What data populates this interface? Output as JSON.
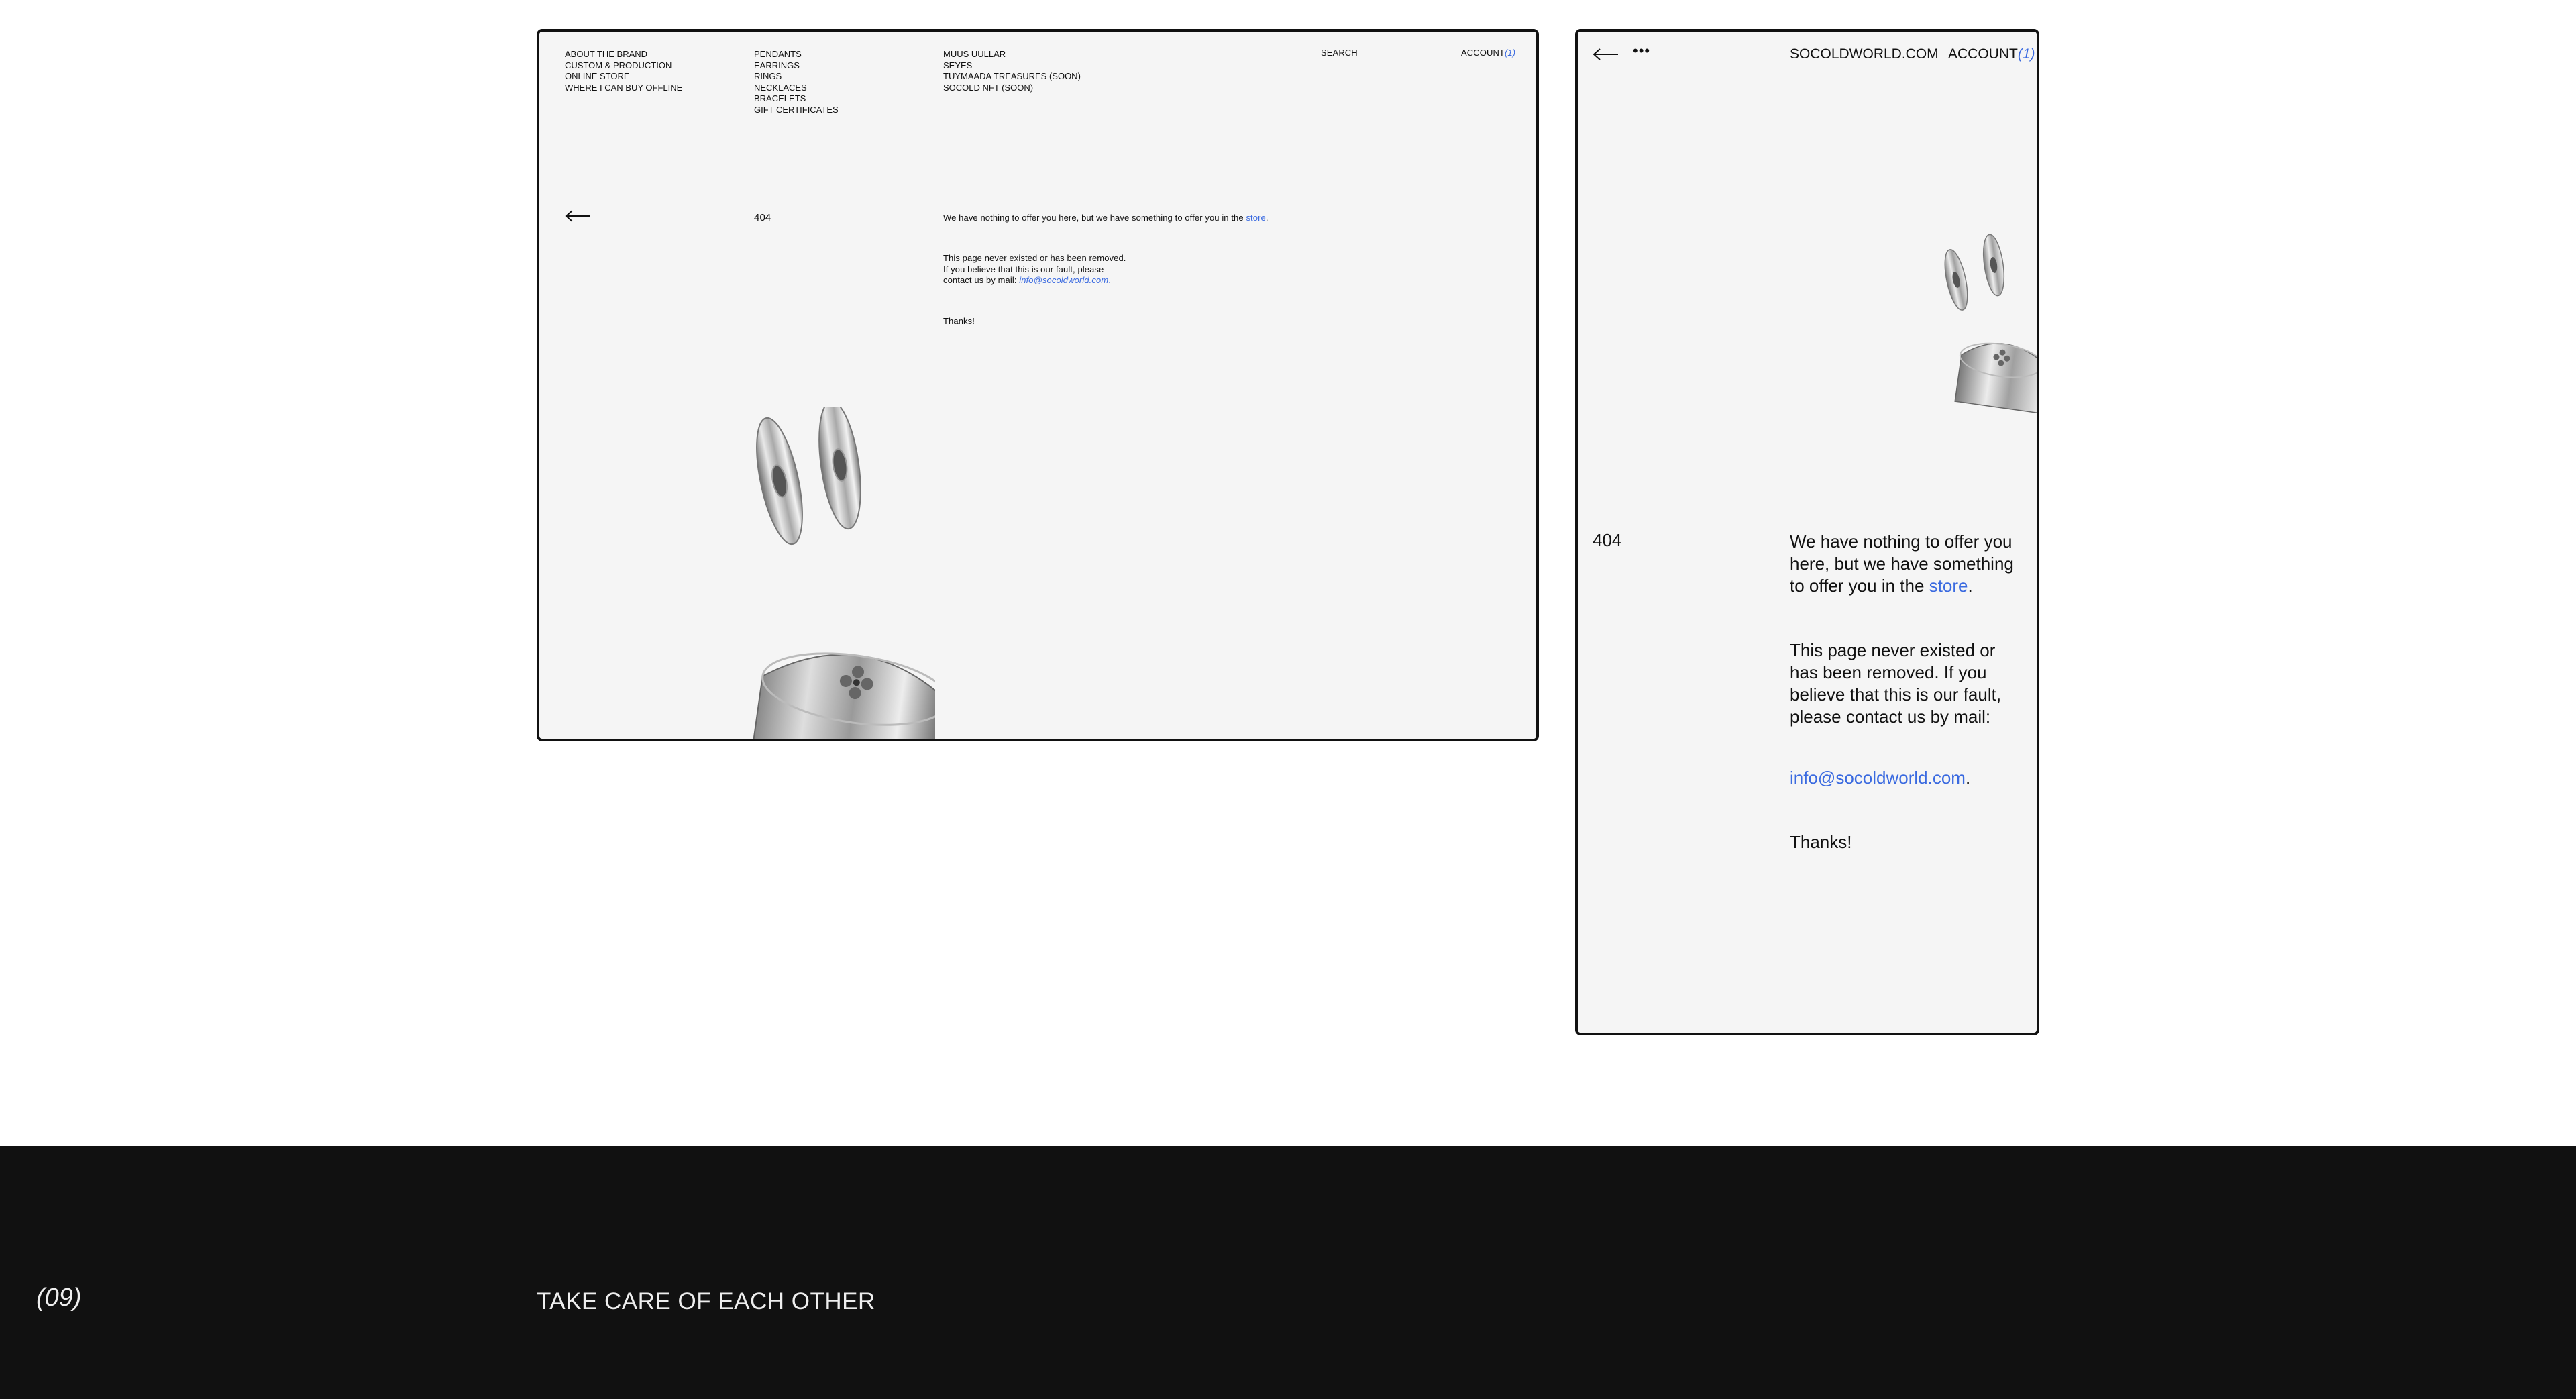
{
  "desktop": {
    "nav_col1": [
      "ABOUT THE BRAND",
      "CUSTOM & PRODUCTION",
      "ONLINE STORE",
      "WHERE I CAN BUY OFFLINE"
    ],
    "nav_col2": [
      "PENDANTS",
      "EARRINGS",
      "RINGS",
      "NECKLACES",
      "BRACELETS",
      "GIFT CERTIFICATES"
    ],
    "nav_col3": [
      "MUUS UULLAR",
      "SEYES",
      "TUYMAADA TREASURES (SOON)",
      "SOCOLD NFT (SOON)"
    ],
    "search_label": "SEARCH",
    "account_label": "ACCOUNT",
    "account_count": "(1)",
    "error_code": "404",
    "message_prefix": "We have nothing to offer you here, but we have something to offer you in the ",
    "store_link": "store",
    "message_suffix": ".",
    "removed_line1": "This page never existed or has been removed.",
    "removed_line2": "If you believe that this is our fault, please",
    "removed_line3_prefix": "contact us by mail: ",
    "email": "info@socoldworld.com",
    "email_suffix": ".",
    "thanks": "Thanks!"
  },
  "mobile": {
    "menu_dots": "•••",
    "site_title": "SOCOLDWORLD.COM",
    "account_label": "ACCOUNT",
    "account_count": "(1)",
    "error_code": "404",
    "message_prefix": "We have nothing to offer you here, but we have something to offer you in the ",
    "store_link": "store",
    "message_suffix": ".",
    "removed_text": "This page never existed or has been removed. If you believe that this is our fault, please contact us by mail:",
    "email": "info@socoldworld.com",
    "email_suffix": ".",
    "thanks": "Thanks!"
  },
  "footer": {
    "section_number": "(09)",
    "tagline": "TAKE CARE OF EACH OTHER"
  },
  "colors": {
    "accent_link": "#3a6ae0",
    "footer_bg": "#111111",
    "screen_bg": "#f5f5f5"
  },
  "icons": [
    "back-arrow-icon",
    "more-dots-icon",
    "earring-image",
    "ring-image"
  ]
}
